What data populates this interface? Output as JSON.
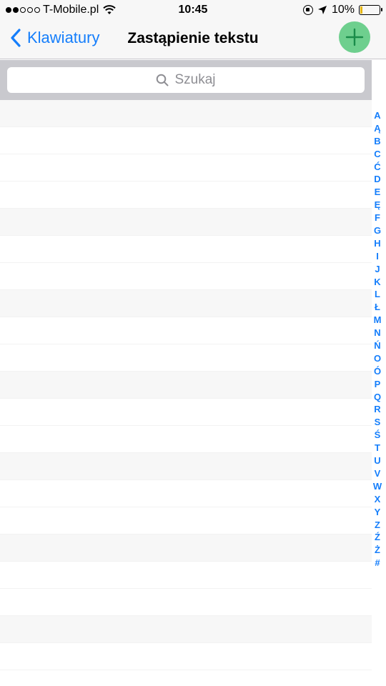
{
  "status_bar": {
    "carrier": "T-Mobile.pl",
    "time": "10:45",
    "battery": "10%",
    "signal_strength": 2,
    "icons": [
      "signal-icon",
      "wifi-icon",
      "orientation-lock-icon",
      "location-icon",
      "battery-icon"
    ]
  },
  "nav": {
    "back_label": "Klawiatury",
    "title": "Zastąpienie tekstu",
    "add_icon": "plus-icon",
    "accent": "#157efb",
    "add_button_color": "#6ecf8e"
  },
  "search": {
    "placeholder": "Szukaj"
  },
  "section_index": [
    "A",
    "Ą",
    "B",
    "C",
    "Ć",
    "D",
    "E",
    "Ę",
    "F",
    "G",
    "H",
    "I",
    "J",
    "K",
    "L",
    "Ł",
    "M",
    "N",
    "Ń",
    "O",
    "Ó",
    "P",
    "Q",
    "R",
    "S",
    "Ś",
    "T",
    "U",
    "V",
    "W",
    "X",
    "Y",
    "Z",
    "Ź",
    "Ż",
    "#"
  ]
}
